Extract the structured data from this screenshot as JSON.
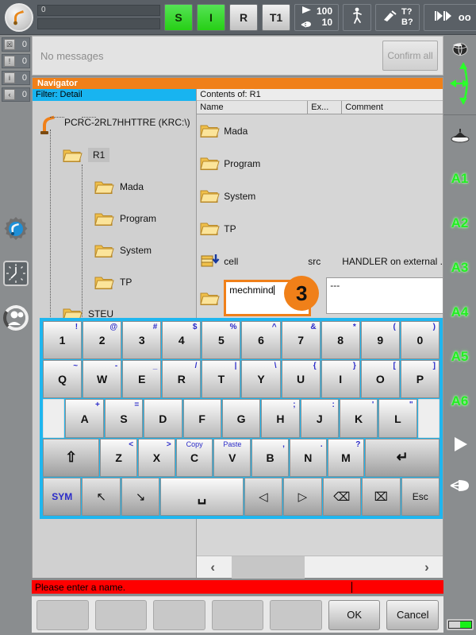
{
  "topbar": {
    "logo_icon": "kuka-robot-icon",
    "status_field_value": "0",
    "status_field_secondary": "",
    "buttons": [
      {
        "label": "S",
        "state": "green",
        "name": "drives-ready-s-button"
      },
      {
        "label": "I",
        "state": "green",
        "name": "drives-on-i-button"
      },
      {
        "label": "R",
        "state": "gray",
        "name": "robot-interpreter-r-button"
      },
      {
        "label": "T1",
        "state": "gray",
        "name": "operating-mode-t1-button"
      }
    ],
    "override": {
      "program_override": "100",
      "jog_override": "10",
      "program_icon": "play-triangle-icon",
      "jog_icon": "hand-jog-icon"
    },
    "increment_icon": "walking-man-icon",
    "tool_base": {
      "icon": "tool-base-icon",
      "tool_label": "T?",
      "base_label": "B?"
    },
    "increment_mode_icon": "increment-arrows-icon",
    "increment_value": "oo"
  },
  "counters": [
    {
      "icon": "stop-message-icon",
      "count": "0",
      "name": "counter-acknowledge-messages"
    },
    {
      "icon": "warning-message-icon",
      "count": "0",
      "name": "counter-state-messages"
    },
    {
      "icon": "info-message-icon",
      "count": "0",
      "name": "counter-notification-messages"
    },
    {
      "icon": "waiting-message-icon",
      "count": "0",
      "name": "counter-waiting-messages"
    }
  ],
  "message_bar": {
    "text": "No messages",
    "confirm_all_label": "Confirm all"
  },
  "left_rail": [
    {
      "icon": "gear-robot-icon",
      "name": "configuration-icon"
    },
    {
      "icon": "clock-icon",
      "name": "clock-icon"
    },
    {
      "icon": "user-group-icon",
      "name": "user-group-icon"
    }
  ],
  "navigator": {
    "title": "Navigator",
    "filter_label": "Filter: Detail",
    "contents_of_label": "Contents of: R1",
    "tree": {
      "root": {
        "label": "PCRC-2RL7HHTTRE (KRC:\\)",
        "icon": "robot-icon"
      },
      "nodes": [
        {
          "label": "R1",
          "level": 1,
          "selected": true,
          "icon": "folder-icon"
        },
        {
          "label": "Mada",
          "level": 2,
          "selected": false,
          "icon": "folder-icon"
        },
        {
          "label": "Program",
          "level": 2,
          "selected": false,
          "icon": "folder-icon"
        },
        {
          "label": "System",
          "level": 2,
          "selected": false,
          "icon": "folder-icon"
        },
        {
          "label": "TP",
          "level": 2,
          "selected": false,
          "icon": "folder-icon"
        },
        {
          "label": "STEU",
          "level": 1,
          "selected": false,
          "icon": "folder-icon"
        }
      ]
    },
    "columns": [
      {
        "label": "Name"
      },
      {
        "label": "Ex..."
      },
      {
        "label": "Comment"
      }
    ],
    "rows": [
      {
        "icon": "folder-icon",
        "name": "Mada",
        "ext": "",
        "comment": ""
      },
      {
        "icon": "folder-icon",
        "name": "Program",
        "ext": "",
        "comment": ""
      },
      {
        "icon": "folder-icon",
        "name": "System",
        "ext": "",
        "comment": ""
      },
      {
        "icon": "folder-icon",
        "name": "TP",
        "ext": "",
        "comment": ""
      },
      {
        "icon": "module-src-icon",
        "name": "cell",
        "ext": "src",
        "comment": "HANDLER on external ."
      }
    ],
    "edit_row": {
      "icon": "folder-icon",
      "input_value": "mechmind",
      "comment_value": "---",
      "callout_number": "3"
    },
    "hscroll": {
      "left_arrow": "‹",
      "right_arrow": "›"
    }
  },
  "keyboard": {
    "rows": [
      [
        {
          "main": "1",
          "alt": "!"
        },
        {
          "main": "2",
          "alt": "@"
        },
        {
          "main": "3",
          "alt": "#"
        },
        {
          "main": "4",
          "alt": "$"
        },
        {
          "main": "5",
          "alt": "%"
        },
        {
          "main": "6",
          "alt": "^"
        },
        {
          "main": "7",
          "alt": "&"
        },
        {
          "main": "8",
          "alt": "*"
        },
        {
          "main": "9",
          "alt": "("
        },
        {
          "main": "0",
          "alt": ")"
        }
      ],
      [
        {
          "main": "Q",
          "alt": "~"
        },
        {
          "main": "W",
          "alt": "-"
        },
        {
          "main": "E",
          "alt": "_"
        },
        {
          "main": "R",
          "alt": "/"
        },
        {
          "main": "T",
          "alt": "|"
        },
        {
          "main": "Y",
          "alt": "\\"
        },
        {
          "main": "U",
          "alt": "{"
        },
        {
          "main": "I",
          "alt": "}"
        },
        {
          "main": "O",
          "alt": "["
        },
        {
          "main": "P",
          "alt": "]"
        }
      ],
      [
        {
          "main": "A",
          "alt": "+"
        },
        {
          "main": "S",
          "alt": "="
        },
        {
          "main": "D",
          "alt": ""
        },
        {
          "main": "F",
          "alt": ""
        },
        {
          "main": "G",
          "alt": ""
        },
        {
          "main": "H",
          "alt": ";"
        },
        {
          "main": "J",
          "alt": ":"
        },
        {
          "main": "K",
          "alt": "'"
        },
        {
          "main": "L",
          "alt": "\""
        }
      ],
      [
        {
          "main": "⇧",
          "alt": "",
          "kind": "shift",
          "name": "shift-key"
        },
        {
          "main": "Z",
          "alt": "<"
        },
        {
          "main": "X",
          "alt": ">"
        },
        {
          "main": "C",
          "alt": "Copy",
          "alt_word": true
        },
        {
          "main": "V",
          "alt": "Paste",
          "alt_word": true
        },
        {
          "main": "B",
          "alt": ","
        },
        {
          "main": "N",
          "alt": "."
        },
        {
          "main": "M",
          "alt": "?"
        },
        {
          "main": "↵",
          "alt": "",
          "kind": "enter",
          "name": "enter-key"
        }
      ],
      [
        {
          "main": "SYM",
          "alt": "",
          "kind": "sym",
          "name": "sym-key"
        },
        {
          "main": "↖",
          "alt": "",
          "kind": "arrow",
          "name": "home-key"
        },
        {
          "main": "↘",
          "alt": "",
          "kind": "arrow",
          "name": "end-key"
        },
        {
          "main": "␣",
          "alt": "",
          "kind": "space",
          "name": "space-key"
        },
        {
          "main": "◁",
          "alt": "",
          "kind": "arrow",
          "name": "cursor-left-key"
        },
        {
          "main": "▷",
          "alt": "",
          "kind": "arrow",
          "name": "cursor-right-key"
        },
        {
          "main": "⌫",
          "alt": "",
          "kind": "arrow",
          "name": "backspace-key"
        },
        {
          "main": "⌧",
          "alt": "",
          "kind": "arrow",
          "name": "delete-key"
        },
        {
          "main": "Esc",
          "alt": "",
          "kind": "esc",
          "name": "escape-key"
        }
      ]
    ]
  },
  "status_message": {
    "text": "Please enter a name."
  },
  "function_bar": {
    "buttons": [
      {
        "label": "",
        "active": false
      },
      {
        "label": "",
        "active": false
      },
      {
        "label": "",
        "active": false
      },
      {
        "label": "",
        "active": false
      },
      {
        "label": "",
        "active": false
      },
      {
        "label": "OK",
        "active": true
      },
      {
        "label": "Cancel",
        "active": true
      }
    ]
  },
  "right_rail": {
    "world_icon": "world-globe-icon",
    "jog_cross_icon": "jog-direction-cross-icon",
    "coord_icon": "coordinate-system-icon",
    "axes": [
      "A1",
      "A2",
      "A3",
      "A4",
      "A5",
      "A6"
    ],
    "play_icon": "play-triangle-icon",
    "hand_icon": "hand-jog-icon",
    "battery_icon": "battery-icon"
  },
  "colors": {
    "accent_orange": "#f08019",
    "accent_blue": "#18b4f0",
    "status_red": "#ff0000",
    "green_on": "#27cf16",
    "axis_green": "#22ee22"
  }
}
